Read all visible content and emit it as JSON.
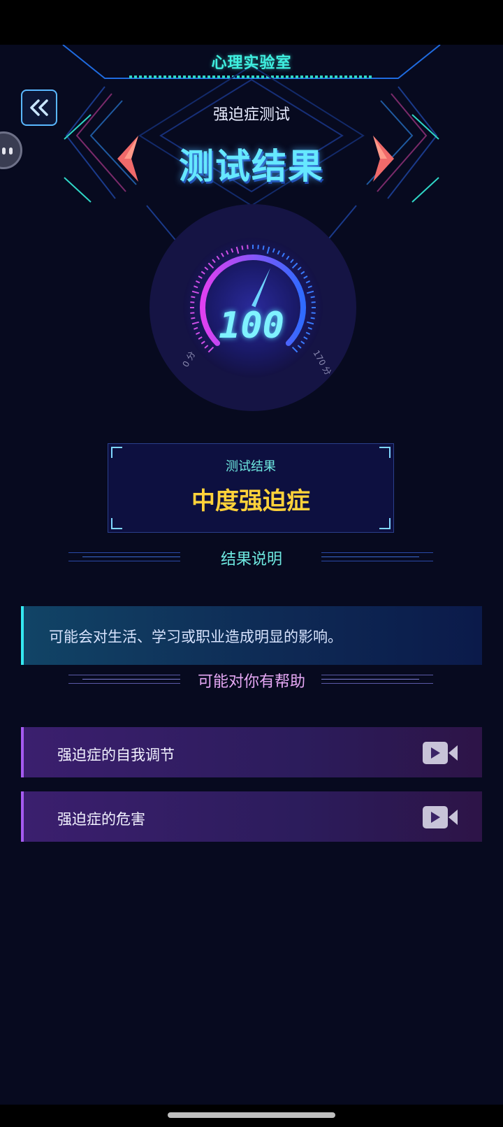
{
  "header": {
    "lab_title": "心理实验室",
    "subtitle": "强迫症测试",
    "title": "测试结果"
  },
  "gauge": {
    "value": "100",
    "min_label": "0 分",
    "max_label": "170 分",
    "min": 0,
    "max": 170,
    "score": 100
  },
  "result": {
    "label": "测试结果",
    "level": "中度强迫症"
  },
  "explanation": {
    "heading": "结果说明",
    "text": "可能会对生活、学习或职业造成明显的影响。"
  },
  "help": {
    "heading": "可能对你有帮助",
    "items": [
      {
        "label": "强迫症的自我调节",
        "icon": "video-icon"
      },
      {
        "label": "强迫症的危害",
        "icon": "video-icon"
      }
    ]
  },
  "colors": {
    "background": "#070a1f",
    "accent_cyan": "#3ff0e0",
    "result_yellow": "#ffd23a",
    "purple": "#a55bf0"
  }
}
